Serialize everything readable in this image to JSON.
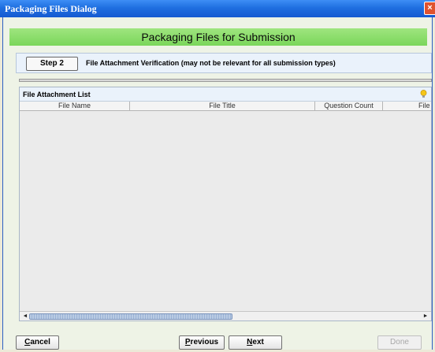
{
  "window": {
    "title": "Packaging Files Dialog",
    "close_glyph": "×"
  },
  "header": {
    "title": "Packaging Files for Submission"
  },
  "step": {
    "button_label": "Step 2",
    "description": "File Attachment Verification (may not be relevant for all submission types)"
  },
  "file_list": {
    "title": "File Attachment List",
    "icon": "lightbulb-icon",
    "columns": [
      "File Name",
      "File Title",
      "Question Count",
      "File"
    ],
    "rows": [],
    "scroll_left_glyph": "◄",
    "scroll_right_glyph": "►"
  },
  "footer": {
    "cancel_label": "Cancel",
    "previous_label": "Previous",
    "next_label": "Next",
    "done_label": "Done"
  },
  "colors": {
    "titlebar": "#1f6fe0",
    "header_band": "#86dc66",
    "step_panel": "#eaf2fb",
    "close_button": "#e0532f"
  }
}
